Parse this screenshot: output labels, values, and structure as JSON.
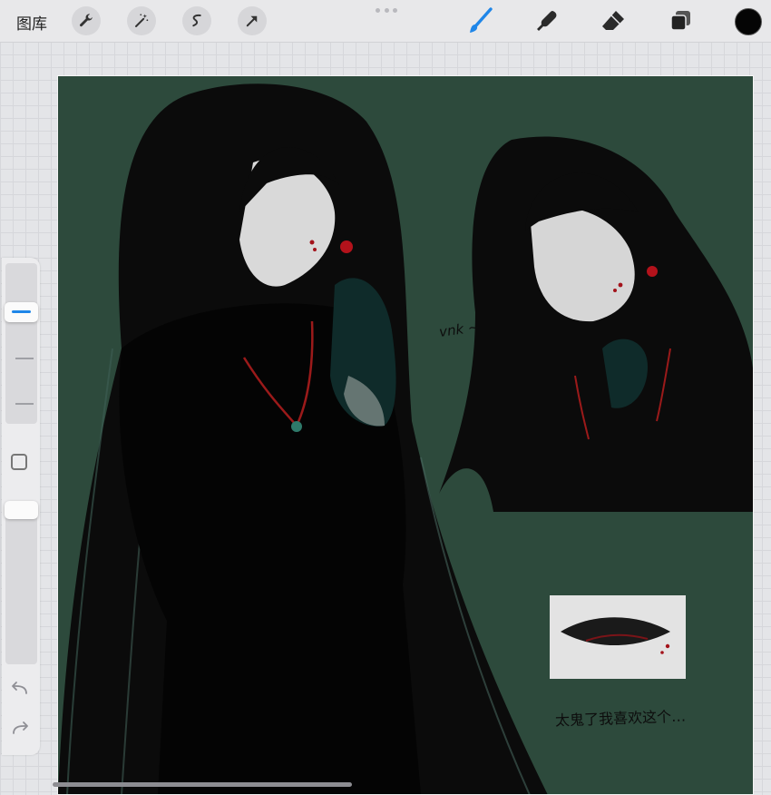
{
  "toolbar": {
    "gallery_label": "图库",
    "left_tools": [
      "wrench-icon",
      "magic-wand-icon",
      "selection-icon",
      "transform-arrow-icon"
    ],
    "right_tools": [
      "brush-icon",
      "smudge-icon",
      "eraser-icon",
      "layers-icon"
    ],
    "active_tool": "brush",
    "color": "#050505",
    "active_tool_color": "#1f86e8"
  },
  "canvas": {
    "background": "#2d4a3c",
    "annotation_sketch": "vnk ~",
    "annotation_caption": "太鬼了我喜欢这个…"
  },
  "sidebar": {
    "size_level": 0.72,
    "opacity_level": 1.0,
    "undo_icon": "undo-arrow-icon",
    "redo_icon": "redo-arrow-icon",
    "modify_icon": "square-modify-icon"
  }
}
